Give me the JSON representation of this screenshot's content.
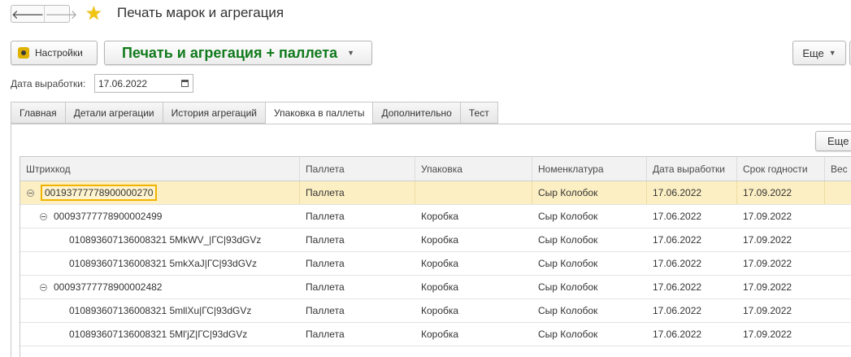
{
  "window": {
    "title": "Печать марок и агрегация"
  },
  "nav": {
    "back": "🡐",
    "forward": "🡒"
  },
  "toolbar": {
    "settings_label": "Настройки",
    "main_label": "Печать и агрегация + паллета",
    "more_label": "Еще"
  },
  "date": {
    "label": "Дата выработки:",
    "value": "17.06.2022"
  },
  "tabs": [
    {
      "label": "Главная",
      "active": false
    },
    {
      "label": "Детали агрегации",
      "active": false
    },
    {
      "label": "История агрегаций",
      "active": false
    },
    {
      "label": "Упаковка в паллеты",
      "active": true
    },
    {
      "label": "Дополнительно",
      "active": false
    },
    {
      "label": "Тест",
      "active": false
    }
  ],
  "panel": {
    "more_label": "Еще"
  },
  "table": {
    "columns": [
      "Штрихкод",
      "Паллета",
      "Упаковка",
      "Номенклатура",
      "Дата выработки",
      "Срок годности",
      "Вес"
    ],
    "rows": [
      {
        "level": 0,
        "toggle": true,
        "barcode": "00193777778900000270",
        "pallet": "Паллета",
        "pack": "",
        "item": "Сыр Колобок",
        "produced": "17.06.2022",
        "expires": "17.09.2022",
        "selected": true
      },
      {
        "level": 1,
        "toggle": true,
        "barcode": "00093777778900002499",
        "pallet": "Паллета",
        "pack": "Коробка",
        "item": "Сыр Колобок",
        "produced": "17.06.2022",
        "expires": "17.09.2022",
        "selected": false
      },
      {
        "level": 2,
        "toggle": false,
        "barcode": "010893607136008321 5MkWV_|ГС|93dGVz",
        "pallet": "Паллета",
        "pack": "Коробка",
        "item": "Сыр Колобок",
        "produced": "17.06.2022",
        "expires": "17.09.2022",
        "selected": false
      },
      {
        "level": 2,
        "toggle": false,
        "barcode": "010893607136008321 5mkXaJ|ГС|93dGVz",
        "pallet": "Паллета",
        "pack": "Коробка",
        "item": "Сыр Колобок",
        "produced": "17.06.2022",
        "expires": "17.09.2022",
        "selected": false
      },
      {
        "level": 1,
        "toggle": true,
        "barcode": "00093777778900002482",
        "pallet": "Паллета",
        "pack": "Коробка",
        "item": "Сыр Колобок",
        "produced": "17.06.2022",
        "expires": "17.09.2022",
        "selected": false
      },
      {
        "level": 2,
        "toggle": false,
        "barcode": "010893607136008321 5mllXu|ГС|93dGVz",
        "pallet": "Паллета",
        "pack": "Коробка",
        "item": "Сыр Колобок",
        "produced": "17.06.2022",
        "expires": "17.09.2022",
        "selected": false
      },
      {
        "level": 2,
        "toggle": false,
        "barcode": "010893607136008321 5Ml'jZ|ГС|93dGVz",
        "pallet": "Паллета",
        "pack": "Коробка",
        "item": "Сыр Колобок",
        "produced": "17.06.2022",
        "expires": "17.09.2022",
        "selected": false
      }
    ]
  }
}
